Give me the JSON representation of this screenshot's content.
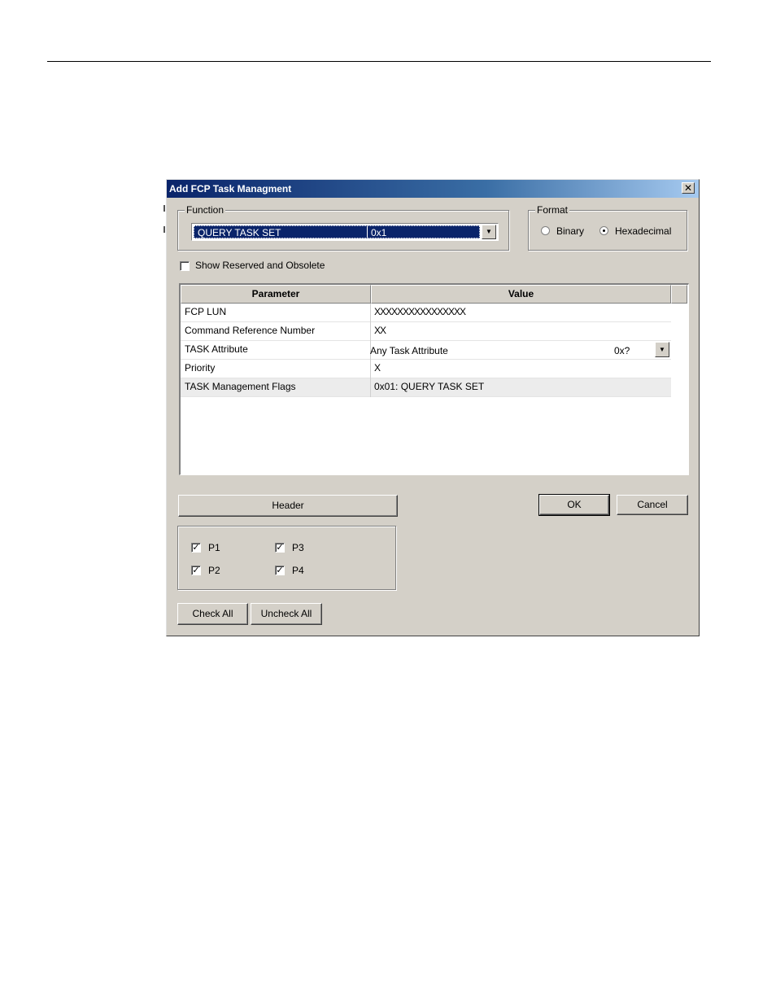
{
  "dialog": {
    "title": "Add FCP Task Managment",
    "close_glyph": "✕"
  },
  "function_group": {
    "label": "Function",
    "selected_name": "QUERY TASK SET",
    "selected_code": "0x1",
    "dropdown_glyph": "▼"
  },
  "format_group": {
    "label": "Format",
    "options": [
      {
        "label": "Binary",
        "selected": false
      },
      {
        "label": "Hexadecimal",
        "selected": true
      }
    ]
  },
  "show_reserved": {
    "label": "Show Reserved and Obsolete",
    "checked": false
  },
  "grid": {
    "columns": [
      "Parameter",
      "Value"
    ],
    "rows": [
      {
        "parameter": "FCP LUN",
        "value": "XXXXXXXXXXXXXXXX"
      },
      {
        "parameter": "Command Reference Number",
        "value": "XX"
      },
      {
        "parameter": "TASK Attribute",
        "value": "Any Task Attribute",
        "code": "0x?"
      },
      {
        "parameter": "Priority",
        "value": "X"
      },
      {
        "parameter": "TASK Management Flags",
        "value": "0x01: QUERY TASK SET"
      }
    ]
  },
  "buttons": {
    "header": "Header",
    "ok": "OK",
    "cancel": "Cancel",
    "check_all": "Check All",
    "uncheck_all": "Uncheck All"
  },
  "ports": [
    {
      "label": "P1",
      "checked": true
    },
    {
      "label": "P2",
      "checked": true
    },
    {
      "label": "P3",
      "checked": true
    },
    {
      "label": "P4",
      "checked": true
    }
  ],
  "check_glyph": "✓"
}
